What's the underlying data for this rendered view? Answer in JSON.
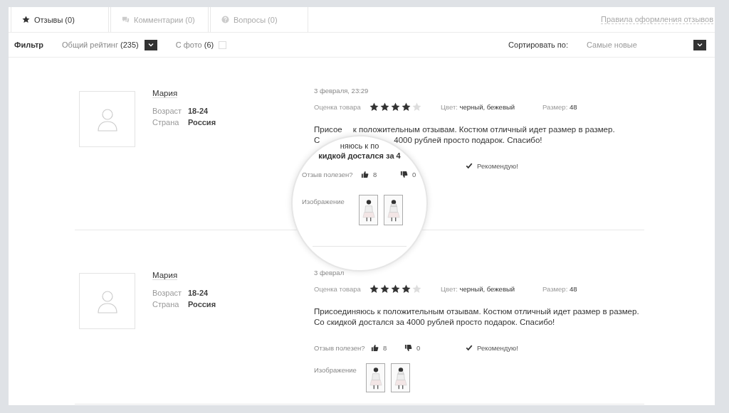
{
  "tabs": [
    {
      "label": "Отзывы (0)",
      "kind": "reviews",
      "selected": true
    },
    {
      "label": "Комментарии (0)",
      "kind": "comments",
      "selected": false
    },
    {
      "label": "Вопросы (0)",
      "kind": "questions",
      "selected": false
    }
  ],
  "rules_link": "Правила оформления отзывов",
  "filter": {
    "label": "Фильтр",
    "rating_filter": {
      "label": "Общий рейтинг",
      "count": "(235)"
    },
    "photo_filter": {
      "label": "С фото",
      "count": "(6)",
      "checked": false
    }
  },
  "sort": {
    "label": "Сортировать по:",
    "value": "Самые новые"
  },
  "reviews": [
    {
      "author": "Мария",
      "age_label": "Возраст",
      "age": "18-24",
      "country_label": "Страна",
      "country": "Россия",
      "date": "3 февраля, 23:29",
      "rating_label": "Оценка товара",
      "stars": 4,
      "color_label": "Цвет:",
      "color_value": "черный, бежевый",
      "size_label": "Размер:",
      "size": "48",
      "text_lines": [
        [
          "Присое",
          "к положительным отзывам. Костюм отличный идет размер в размер."
        ],
        [
          "С",
          "4000 рублей просто подарок. Спасибо!"
        ]
      ],
      "recommended": true,
      "recommend_label": "Рекомендую!",
      "magnifier": {
        "text_lines": [
          "няюсь к по",
          "кидкой достался за 4"
        ],
        "helpful_label": "Отзыв полезен?",
        "likes": "8",
        "dislikes": "0",
        "images_label": "Изображение",
        "images": [
          {
            "kind": "front"
          },
          {
            "kind": "back"
          }
        ]
      }
    },
    {
      "author": "Мария",
      "age_label": "Возраст",
      "age": "18-24",
      "country_label": "Страна",
      "country": "Россия",
      "date": "3 феврал",
      "rating_label": "Оценка товара",
      "stars": 4,
      "color_label": "Цвет:",
      "color_value": "черный, бежевый",
      "size_label": "Размер:",
      "size": "48",
      "text_lines": [
        [
          "Присоединяюсь к положительным отзывам. Костюм отличный идет размер в размер."
        ],
        [
          "Со скидкой достался за 4000 рублей просто подарок. Спасибо!"
        ]
      ],
      "helpful_label": "Отзыв полезен?",
      "likes": "8",
      "dislikes": "0",
      "recommended": true,
      "recommend_label": "Рекомендую!",
      "images_label": "Изображение",
      "images": [
        {
          "kind": "front"
        },
        {
          "kind": "back"
        }
      ]
    }
  ]
}
